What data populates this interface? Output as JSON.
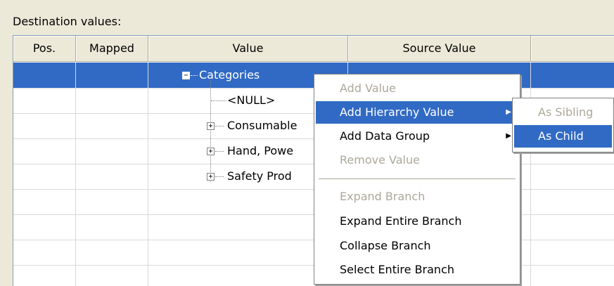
{
  "section_label": "Destination values:",
  "columns": [
    "Pos.",
    "Mapped",
    "Value",
    "Source Value"
  ],
  "tree": [
    {
      "label": "Categories",
      "expander": "−"
    },
    {
      "label": "<NULL>"
    },
    {
      "label": "Consumable",
      "expander": "+"
    },
    {
      "label": "Hand, Powe",
      "expander": "+"
    },
    {
      "label": "Safety Prod",
      "expander": "+"
    }
  ],
  "context_menu": {
    "items": [
      {
        "label": "Add Value",
        "enabled": false
      },
      {
        "label": "Add Hierarchy Value",
        "enabled": true,
        "submenu": true,
        "highlighted": true
      },
      {
        "label": "Add Data Group",
        "enabled": true,
        "submenu": true
      },
      {
        "label": "Remove Value",
        "enabled": false
      },
      {
        "label": "Expand Branch",
        "enabled": false
      },
      {
        "label": "Expand Entire Branch",
        "enabled": true
      },
      {
        "label": "Collapse Branch",
        "enabled": true
      },
      {
        "label": "Select Entire Branch",
        "enabled": true
      }
    ],
    "submenu_arrow": "▶"
  },
  "submenu": {
    "items": [
      {
        "label": "As Sibling",
        "enabled": false
      },
      {
        "label": "As Child",
        "enabled": true,
        "highlighted": true
      }
    ]
  },
  "colors": {
    "selection": "#316ac5",
    "disabled_text": "#aca899"
  }
}
